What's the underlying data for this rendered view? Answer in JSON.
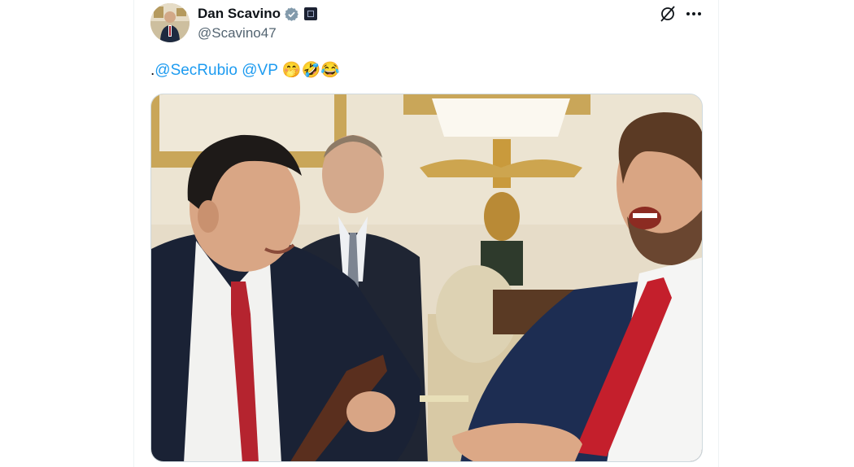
{
  "tweet": {
    "author_name": "Dan Scavino",
    "author_handle": "@Scavino47",
    "text_prefix": ".",
    "mentions": [
      "@SecRubio",
      "@VP"
    ],
    "emojis": [
      "🤭",
      "🤣",
      "😂"
    ]
  },
  "icons": {
    "verified": "verified-badge-icon",
    "affiliate": "affiliate-badge-icon",
    "grok": "grok-icon",
    "more": "more-dots-icon"
  },
  "colors": {
    "link": "#1d9bf0",
    "text": "#0f1419",
    "muted": "#536471"
  }
}
